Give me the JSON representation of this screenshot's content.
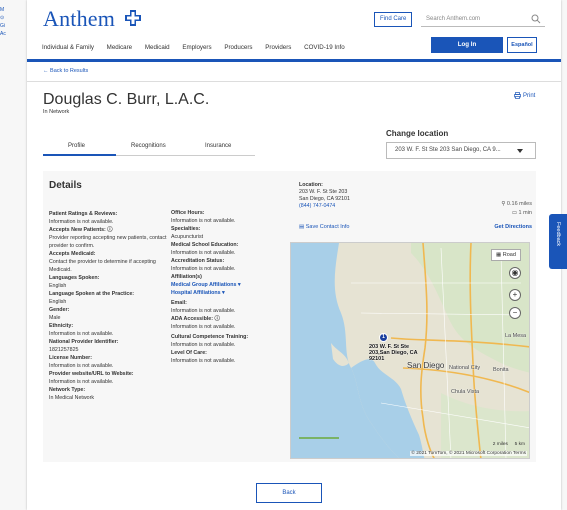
{
  "header": {
    "logo": "Anthem",
    "find_care": "Find Care",
    "search_placeholder": "Search Anthem.com",
    "nav": [
      "Individual & Family",
      "Medicare",
      "Medicaid",
      "Employers",
      "Producers",
      "Providers",
      "COVID-19 Info"
    ],
    "login": "Log In",
    "espanol": "Español",
    "accent": "#1a55b8"
  },
  "breadcrumb": {
    "back": "Back to Results"
  },
  "provider": {
    "name": "Douglas C. Burr, L.A.C.",
    "network": "In Network",
    "print": "Print"
  },
  "tabs": [
    "Profile",
    "Recognitions",
    "Insurance"
  ],
  "change_location": {
    "label": "Change location",
    "selected": "203 W. F. St Ste 203 San Diego, CA 9..."
  },
  "details": {
    "title": "Details",
    "col1": [
      {
        "label": "Patient Ratings & Reviews:",
        "value": "Information is not available."
      },
      {
        "label": "Accepts New Patients:",
        "value": "Provider reporting accepting new patients, contact provider to confirm."
      },
      {
        "label": "Accepts Medicaid:",
        "value": "Contact the provider to determine if accepting Medicaid."
      },
      {
        "label": "Languages Spoken:",
        "value": "English"
      },
      {
        "label": "Language Spoken at the Practice:",
        "value": "English"
      },
      {
        "label": "Gender:",
        "value": "Male"
      },
      {
        "label": "Ethnicity:",
        "value": "Information is not available."
      },
      {
        "label": "National Provider Identifier:",
        "value": "1821257825"
      },
      {
        "label": "License Number:",
        "value": "Information is not available."
      },
      {
        "label": "Provider website/URL to Website:",
        "value": "Information is not available."
      },
      {
        "label": "Network Type:",
        "value": "In Medical Network"
      }
    ],
    "col2": {
      "office_hours_label": "Office Hours:",
      "office_hours": "Information is not available.",
      "specialties_label": "Specialties:",
      "specialties": "Acupuncturist",
      "school_label": "Medical School Education:",
      "school": "Information is not available.",
      "accreditation_label": "Accreditation Status:",
      "accreditation": "Information is not available.",
      "affiliations_label": "Affiliation(s)",
      "group_aff": "Medical Group Affiliations",
      "hospital_aff": "Hospital Affiliations",
      "email_label": "Email:",
      "email": "Information is not available.",
      "ada_label": "ADA Accessible:",
      "ada": "Information is not available.",
      "cultural_label": "Cultural Competence Training:",
      "cultural": "Information is not available.",
      "level_label": "Level Of Care:",
      "level": "Information is not available."
    }
  },
  "location": {
    "label": "Location:",
    "line1": "203 W. F. St Ste 203",
    "line2": "San Diego, CA 92101",
    "phone": "(844) 747-0474",
    "distance": "0.16 miles",
    "drive": "1 min",
    "save_contact": "Save Contact Info",
    "directions": "Get Directions"
  },
  "map": {
    "road": "Road",
    "pin_label_1": "203 W. F. St Ste",
    "pin_label_2": "203,San Diego, CA 92101",
    "city": "San Diego",
    "national_city": "National City",
    "bonita": "Bonita",
    "chula": "Chula Vista",
    "la_mesa": "La Mesa",
    "scale_mi": "2 miles",
    "scale_km": "5 km",
    "copyright": "© 2021 TomTom, © 2021 Microsoft Corporation  Terms"
  },
  "back_button": "Back",
  "feedback": "Feedback"
}
